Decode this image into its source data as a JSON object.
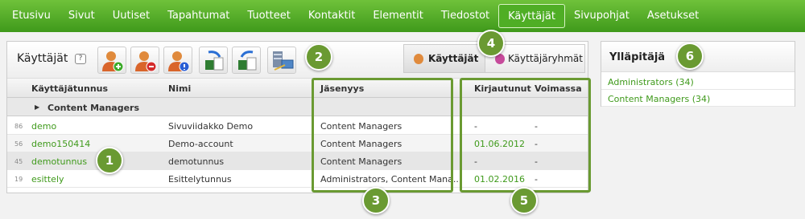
{
  "nav": {
    "items": [
      "Etusivu",
      "Sivut",
      "Uutiset",
      "Tapahtumat",
      "Tuotteet",
      "Kontaktit",
      "Elementit",
      "Tiedostot",
      "Käyttäjät",
      "Sivupohjat",
      "Asetukset"
    ],
    "active": "Käyttäjät"
  },
  "toolbar": {
    "title": "Käyttäjät",
    "help": "?",
    "tabs": [
      {
        "label": "Käyttäjät",
        "selected": true
      },
      {
        "label": "Käyttäjäryhmät",
        "selected": false
      }
    ]
  },
  "table": {
    "columns": [
      "Käyttäjätunnus",
      "Nimi",
      "Jäsenyys",
      "Kirjautunut",
      "Voimassa"
    ],
    "group": "Content Managers",
    "rows": [
      {
        "id": "86",
        "username": "demo",
        "name": "Sivuviidakko Demo",
        "membership": "Content Managers",
        "logged_in": "-",
        "valid": "-"
      },
      {
        "id": "56",
        "username": "demo150414",
        "name": "Demo-account",
        "membership": "Content Managers",
        "logged_in": "01.06.2012",
        "valid": "-"
      },
      {
        "id": "45",
        "username": "demotunnus",
        "name": "demotunnus",
        "membership": "Content Managers",
        "logged_in": "-",
        "valid": "-"
      },
      {
        "id": "19",
        "username": "esittely",
        "name": "Esittelytunnus",
        "membership": "Administrators, Content Mana...",
        "logged_in": "01.02.2016",
        "valid": "-"
      }
    ]
  },
  "admin": {
    "title": "Ylläpitäjä",
    "items": [
      "Administrators (34)",
      "Content Managers (34)"
    ]
  },
  "callouts": [
    "1",
    "2",
    "3",
    "4",
    "5",
    "6"
  ],
  "colors": {
    "brand_green": "#3f9a1b",
    "callout": "#6a9a32"
  },
  "icons": [
    "add-user-icon",
    "remove-user-icon",
    "user-info-icon",
    "import-excel-icon",
    "export-excel-icon",
    "server-sync-icon",
    "expand-arrow-icon"
  ]
}
